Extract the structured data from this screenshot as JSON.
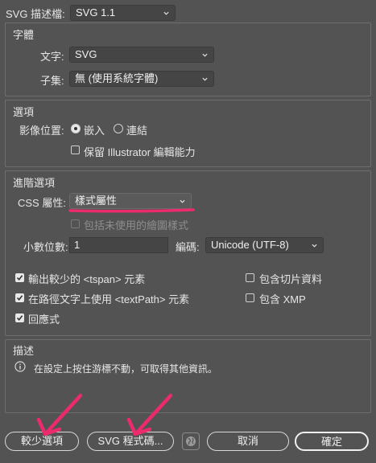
{
  "header": {
    "profile_label": "SVG 描述檔:",
    "profile_value": "SVG 1.1"
  },
  "fonts": {
    "title": "字體",
    "type_label": "文字:",
    "type_value": "SVG",
    "subset_label": "子集:",
    "subset_value": "無 (使用系統字體)"
  },
  "options": {
    "title": "選項",
    "image_location_label": "影像位置:",
    "embed_label": "嵌入",
    "link_label": "連結",
    "preserve_label": "保留 Illustrator 編輯能力"
  },
  "advanced": {
    "title": "進階選項",
    "css_label": "CSS 屬性:",
    "css_value": "樣式屬性",
    "unused_styles_label": "包括未使用的繪圖樣式",
    "decimal_label": "小數位數:",
    "decimal_value": "1",
    "encoding_label": "編碼:",
    "encoding_value": "Unicode (UTF-8)",
    "output_tspan_label": "輸出較少的 <tspan> 元素",
    "textpath_label": "在路徑文字上使用 <textPath> 元素",
    "responsive_label": "回應式",
    "slicing_label": "包含切片資料",
    "xmp_label": "包含 XMP"
  },
  "description": {
    "title": "描述",
    "hint": "在設定上按住游標不動，可取得其他資訊。"
  },
  "buttons": {
    "less_options": "較少選項",
    "svg_code": "SVG 程式碼...",
    "cancel": "取消",
    "ok": "確定"
  },
  "colors": {
    "background": "#535353",
    "annotation_pink": "#ec2a6e"
  }
}
